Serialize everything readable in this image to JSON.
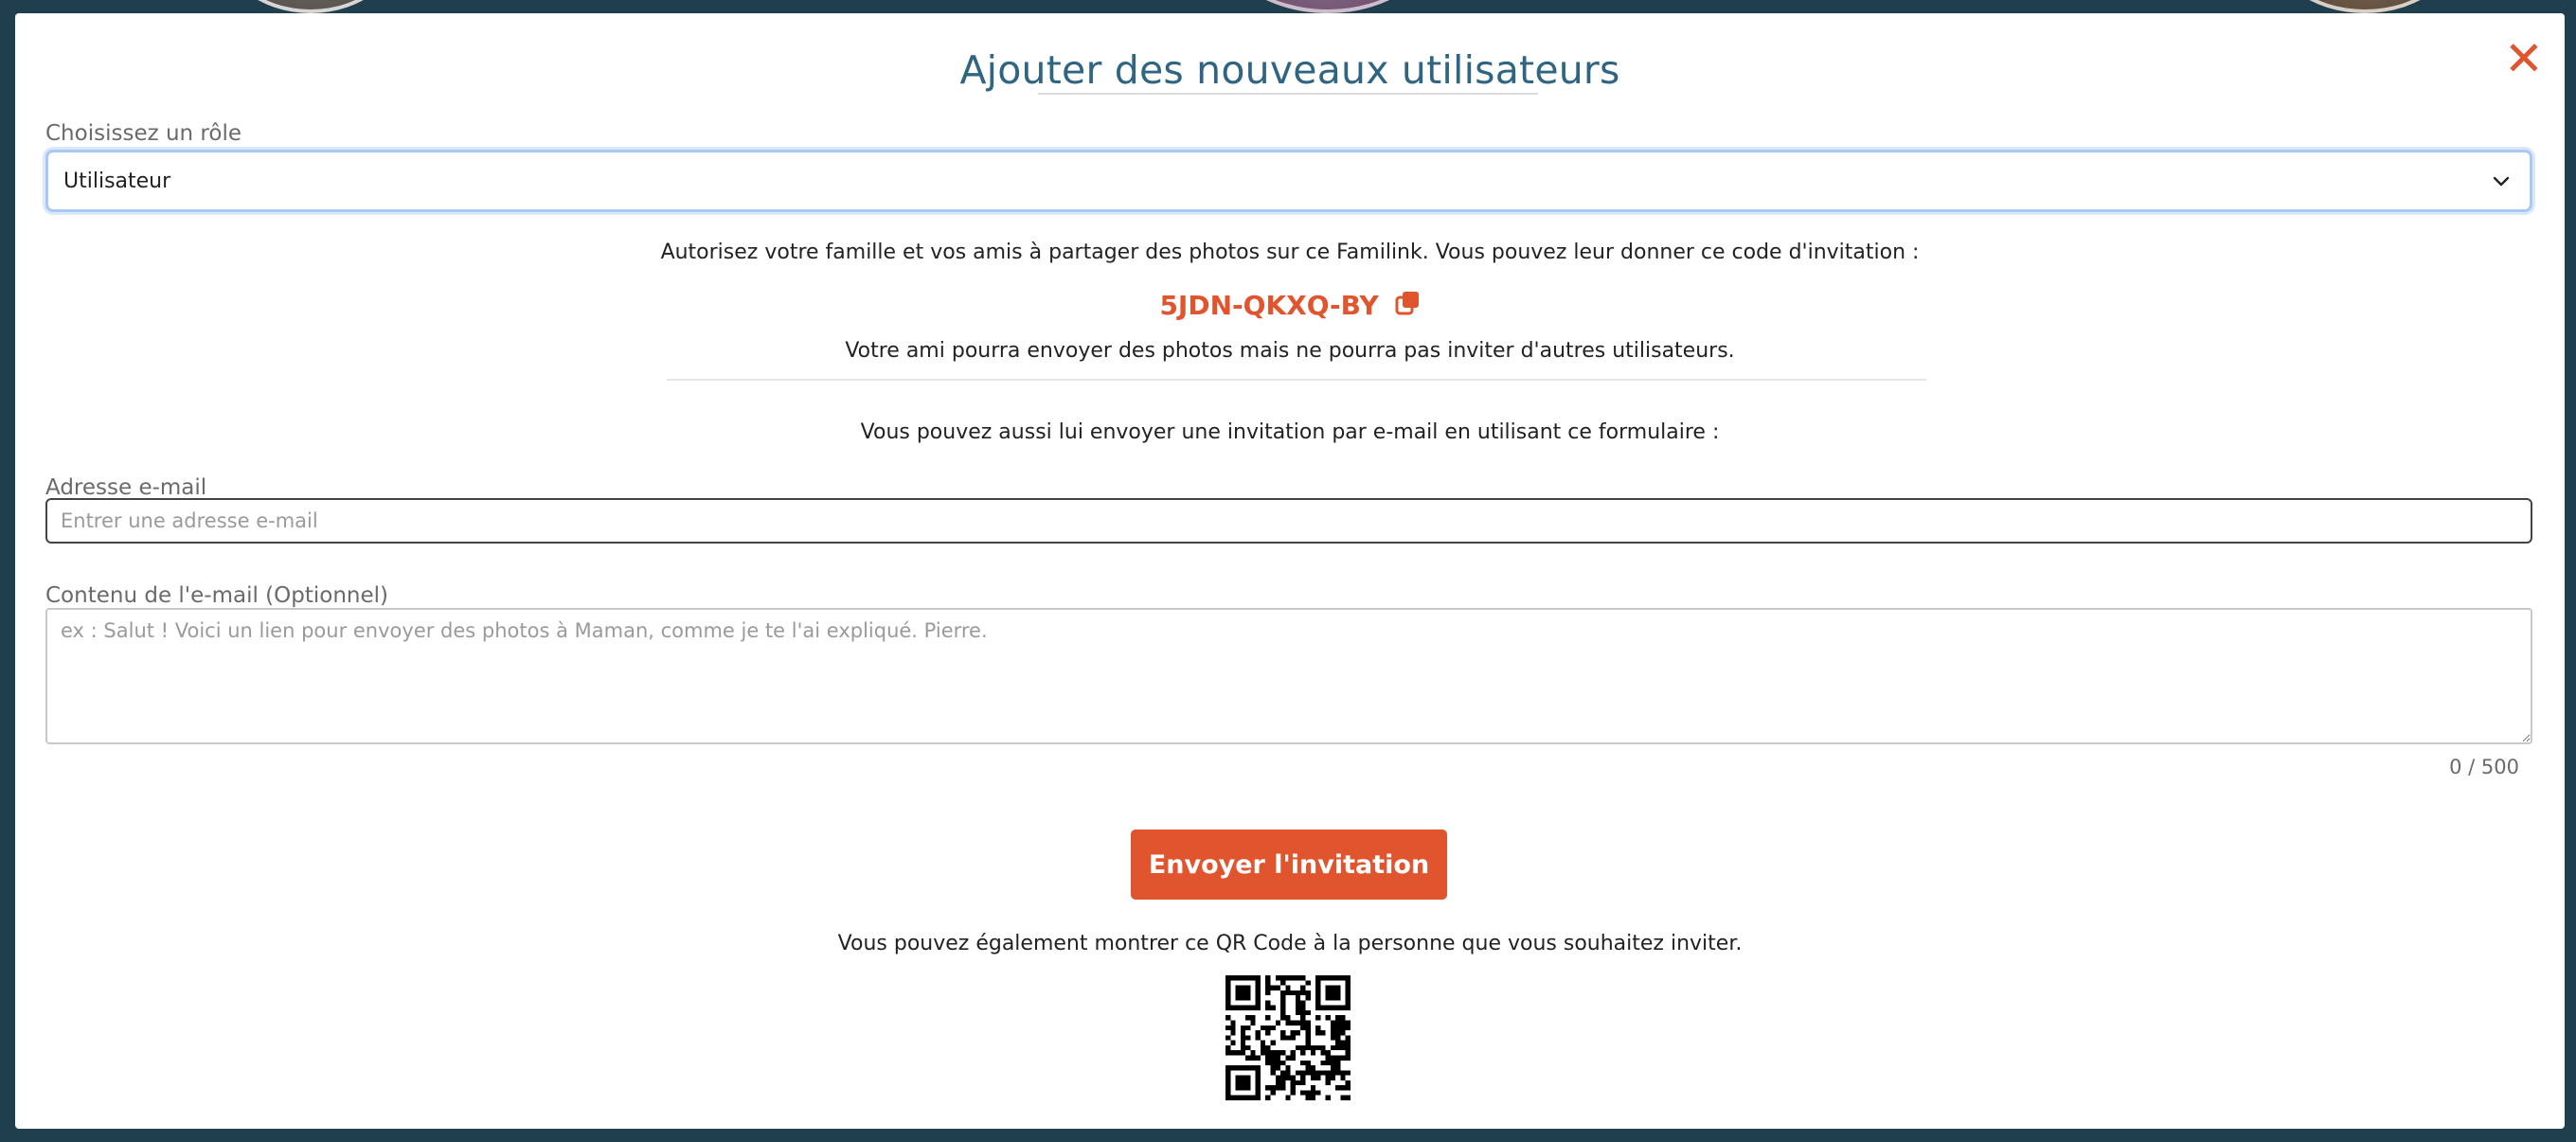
{
  "modal": {
    "title": "Ajouter des nouveaux utilisateurs",
    "close_icon": "close-icon"
  },
  "role": {
    "label": "Choisissez un rôle",
    "selected": "Utilisateur"
  },
  "invite_code": {
    "intro": "Autorisez votre famille et vos amis à partager des photos sur ce Familink. Vous pouvez leur donner ce code d'invitation :",
    "code": "5JDN-QKXQ-BY",
    "copy_icon": "copy-icon",
    "note": "Votre ami pourra envoyer des photos mais ne pourra pas inviter d'autres utilisateurs."
  },
  "email_form": {
    "intro": "Vous pouvez aussi lui envoyer une invitation par e-mail en utilisant ce formulaire :",
    "email_label": "Adresse e-mail",
    "email_placeholder": "Entrer une adresse e-mail",
    "email_value": "",
    "content_label": "Contenu de l'e-mail (Optionnel)",
    "content_placeholder": "ex : Salut ! Voici un lien pour envoyer des photos à Maman, comme je te l'ai expliqué. Pierre.",
    "content_value": "",
    "counter": "0 / 500",
    "send_label": "Envoyer l'invitation"
  },
  "qr": {
    "text": "Vous pouvez également montrer ce QR Code à la personne que vous souhaitez inviter.",
    "icon": "qr-code"
  },
  "colors": {
    "accent": "#e0542e",
    "title": "#2f6582",
    "backdrop": "#1f3f4e"
  }
}
